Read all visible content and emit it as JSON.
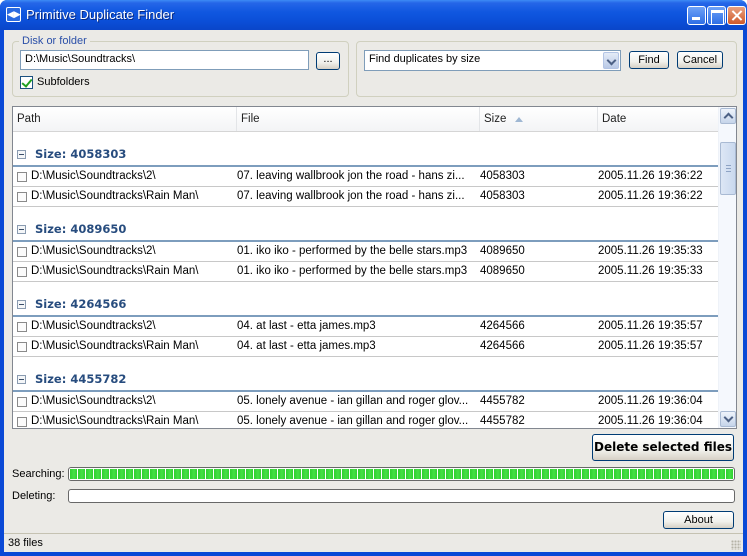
{
  "window": {
    "title": "Primitive Duplicate Finder",
    "icon": "app-icon",
    "controls": [
      "minimize",
      "maximize",
      "close"
    ]
  },
  "disk_group": {
    "legend": "Disk or folder",
    "path_value": "D:\\Music\\Soundtracks\\",
    "browse_label": "...",
    "subfolders_label": "Subfolders",
    "subfolders_checked": true
  },
  "find_group": {
    "mode_selected": "Find duplicates by size",
    "find_label": "Find",
    "cancel_label": "Cancel"
  },
  "list": {
    "columns": [
      "Path",
      "File",
      "Size",
      "Date"
    ],
    "sort_column": "Size",
    "sort_direction": "ascending",
    "groups": [
      {
        "title": "Size: 4058303",
        "rows": [
          {
            "path": "D:\\Music\\Soundtracks\\2\\",
            "file": "07. leaving wallbrook jon the road - hans zi...",
            "size": "4058303",
            "date": "2005.11.26 19:36:22"
          },
          {
            "path": "D:\\Music\\Soundtracks\\Rain Man\\",
            "file": "07. leaving wallbrook jon the road - hans zi...",
            "size": "4058303",
            "date": "2005.11.26 19:36:22"
          }
        ]
      },
      {
        "title": "Size: 4089650",
        "rows": [
          {
            "path": "D:\\Music\\Soundtracks\\2\\",
            "file": "01. iko iko - performed by the belle stars.mp3",
            "size": "4089650",
            "date": "2005.11.26 19:35:33"
          },
          {
            "path": "D:\\Music\\Soundtracks\\Rain Man\\",
            "file": "01. iko iko - performed by the belle stars.mp3",
            "size": "4089650",
            "date": "2005.11.26 19:35:33"
          }
        ]
      },
      {
        "title": "Size: 4264566",
        "rows": [
          {
            "path": "D:\\Music\\Soundtracks\\2\\",
            "file": "04. at last - etta james.mp3",
            "size": "4264566",
            "date": "2005.11.26 19:35:57"
          },
          {
            "path": "D:\\Music\\Soundtracks\\Rain Man\\",
            "file": "04. at last - etta james.mp3",
            "size": "4264566",
            "date": "2005.11.26 19:35:57"
          }
        ]
      },
      {
        "title": "Size: 4455782",
        "rows": [
          {
            "path": "D:\\Music\\Soundtracks\\2\\",
            "file": "05. lonely avenue - ian gillan and roger glov...",
            "size": "4455782",
            "date": "2005.11.26 19:36:04"
          },
          {
            "path": "D:\\Music\\Soundtracks\\Rain Man\\",
            "file": "05. lonely avenue - ian gillan and roger glov...",
            "size": "4455782",
            "date": "2005.11.26 19:36:04"
          }
        ]
      }
    ]
  },
  "actions": {
    "delete_label": "Delete selected files",
    "about_label": "About"
  },
  "progress": {
    "searching_label": "Searching:",
    "searching_percent": 100,
    "deleting_label": "Deleting:",
    "deleting_percent": 0
  },
  "status": {
    "text": "38 files"
  },
  "colors": {
    "titlebar": "#0a4fd8",
    "group_title": "#274c7e",
    "progress_fill": "#2fcf2f"
  }
}
